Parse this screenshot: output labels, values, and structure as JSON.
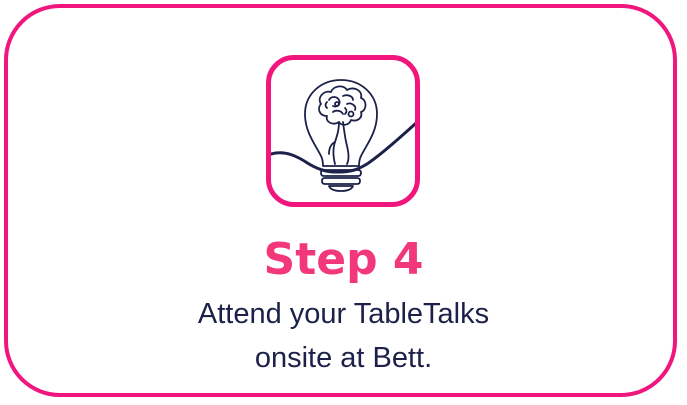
{
  "card": {
    "border_color": "#f0167e",
    "icon": "lightbulb-brain-icon",
    "title": "Step 4",
    "description_line1": "Attend your TableTalks",
    "description_line2": "onsite at Bett."
  },
  "colors": {
    "accent": "#f0167e",
    "title": "#f2387a",
    "text": "#1b2148",
    "icon_stroke": "#1b2148"
  }
}
